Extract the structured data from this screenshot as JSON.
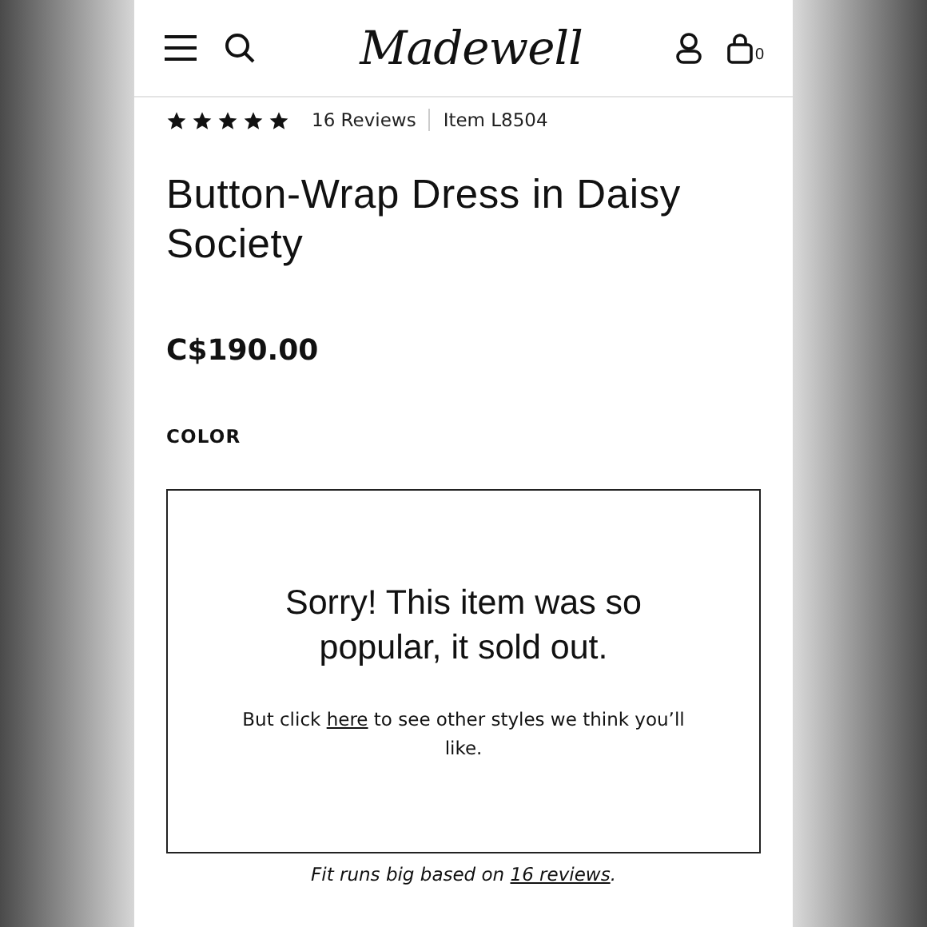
{
  "header": {
    "logo": "Madewell",
    "cart_count": "0"
  },
  "rating": {
    "stars": 5,
    "reviews": "16 Reviews",
    "item": "Item L8504"
  },
  "product": {
    "title": "Button-Wrap Dress in Daisy Society",
    "price": "C$190.00",
    "color_label": "COLOR"
  },
  "sold_out": {
    "heading": "Sorry! This item was so popular, it sold out.",
    "before_link": "But click ",
    "link": "here",
    "after_link": " to see other styles we think you’ll like."
  },
  "fit_note": {
    "before_link": "Fit runs big based on ",
    "link": "16 reviews",
    "after_link": "."
  }
}
